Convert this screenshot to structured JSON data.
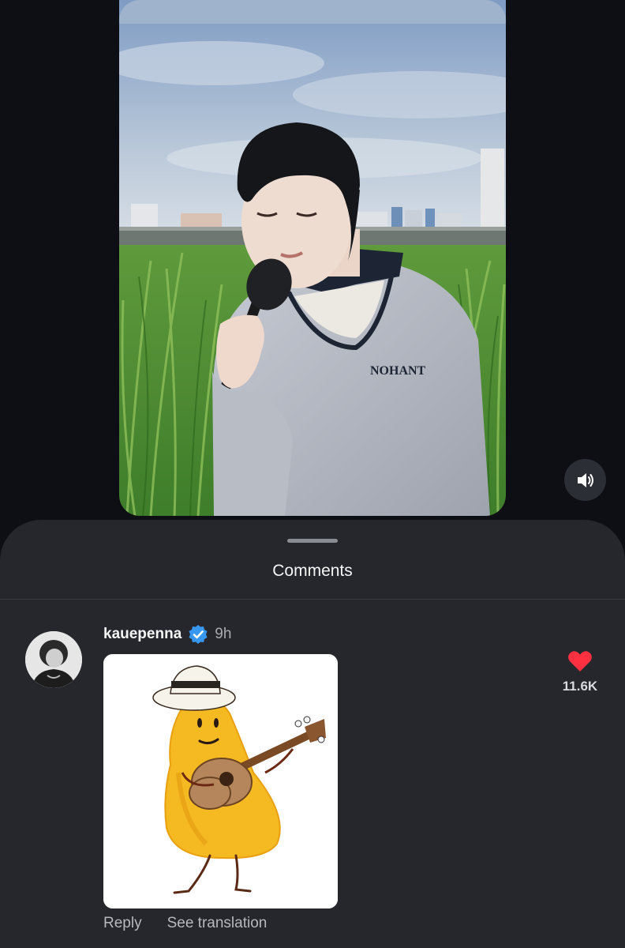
{
  "video": {
    "mute_icon": "speaker-icon"
  },
  "comments_sheet": {
    "title": "Comments"
  },
  "comment": {
    "username": "kauepenna",
    "verified_icon": "verified-badge-icon",
    "time": "9h",
    "like_icon": "heart-icon",
    "like_count": "11.6K",
    "reply_label": "Reply",
    "translate_label": "See translation"
  },
  "colors": {
    "like": "#ff3040",
    "verified": "#3897f0",
    "sheet_background": "#25272d",
    "page_background": "#0d0f14"
  }
}
